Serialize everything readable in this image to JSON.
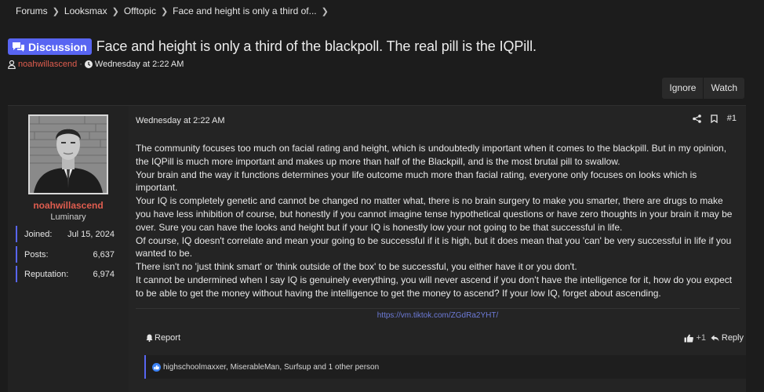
{
  "breadcrumb": [
    {
      "label": "Forums"
    },
    {
      "label": "Looksmax"
    },
    {
      "label": "Offtopic"
    },
    {
      "label": "Face and height is only a third of..."
    }
  ],
  "thread": {
    "prefix": "Discussion",
    "title": "Face and height is only a third of the blackpoll. The real pill is the IQPill.",
    "author": "noahwillascend",
    "separator": "·",
    "date": "Wednesday at 2:22 AM"
  },
  "buttons": {
    "ignore": "Ignore",
    "watch": "Watch"
  },
  "user": {
    "name": "noahwillascend",
    "title": "Luminary",
    "stats": [
      {
        "label": "Joined:",
        "value": "Jul 15, 2024"
      },
      {
        "label": "Posts:",
        "value": "6,637"
      },
      {
        "label": "Reputation:",
        "value": "6,974"
      }
    ]
  },
  "post": {
    "date": "Wednesday at 2:22 AM",
    "number": "#1",
    "lines": [
      "The community focuses too much on facial rating and height, which is undoubtedly important when it comes to the blackpill. But in my opinion, the IQPill is much more important and makes up more than half of the Blackpill, and is the most brutal pill to swallow.",
      "Your brain and the way it functions determines your life outcome much more than facial rating, everyone only focuses on looks which is important.",
      "Your IQ is completely genetic and cannot be changed no matter what, there is no brain surgery to make you smarter, there are drugs to make you have less inhibition of course, but honestly if you cannot imagine tense hypothetical questions or have zero thoughts in your brain it may be over. Sure you can have the looks and height but if your IQ is honestly low your not going to be that successful in life.",
      "Of course, IQ doesn't correlate and mean your going to be successful if it is high, but it does mean that you 'can' be very successful in life if you wanted to be.",
      "There isn't no 'just think smart' or 'think outside of the box' to be successful, you either have it or you don't.",
      "It cannot be undermined when I say IQ is genuinely everything, you will never ascend if you don't have the intelligence for it, how do you expect to be able to get the money without having the intelligence to get the money to ascend? If your low IQ, forget about ascending."
    ],
    "link": "https://vm.tiktok.com/ZGdRa2YHT/",
    "report": "Report",
    "react_count": "+1",
    "reply": "Reply",
    "reactions": "highschoolmaxxer, MiserableMan, Surfsup and 1 other person"
  },
  "colors": {
    "accent": "#5865f2",
    "username": "#e05d4f",
    "link": "#6d7bd8",
    "background": "#1c1c1c"
  },
  "icons": [
    "chevron-right-icon",
    "comments-icon",
    "user-icon",
    "clock-icon",
    "share-icon",
    "bookmark-icon",
    "bell-icon",
    "thumbs-up-icon",
    "reply-icon",
    "like-badge-icon"
  ]
}
